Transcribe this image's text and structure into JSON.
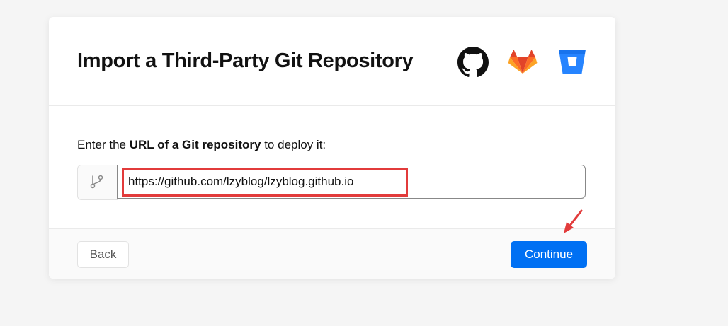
{
  "dialog": {
    "title": "Import a Third-Party Git Repository",
    "providers": [
      {
        "name": "GitHub",
        "icon": "github-icon",
        "color": "#111111"
      },
      {
        "name": "GitLab",
        "icon": "gitlab-icon",
        "color": "#e24329"
      },
      {
        "name": "Bitbucket",
        "icon": "bitbucket-icon",
        "color": "#0052cc"
      }
    ]
  },
  "form": {
    "prompt_prefix": "Enter the ",
    "prompt_bold": "URL of a Git repository",
    "prompt_suffix": " to deploy it:",
    "prefix_icon": "git-branch-icon",
    "url_value": "https://github.com/lzyblog/lzyblog.github.io"
  },
  "footer": {
    "back_label": "Back",
    "continue_label": "Continue"
  },
  "colors": {
    "accent": "#0070f3",
    "annotation": "#e23b3b"
  }
}
